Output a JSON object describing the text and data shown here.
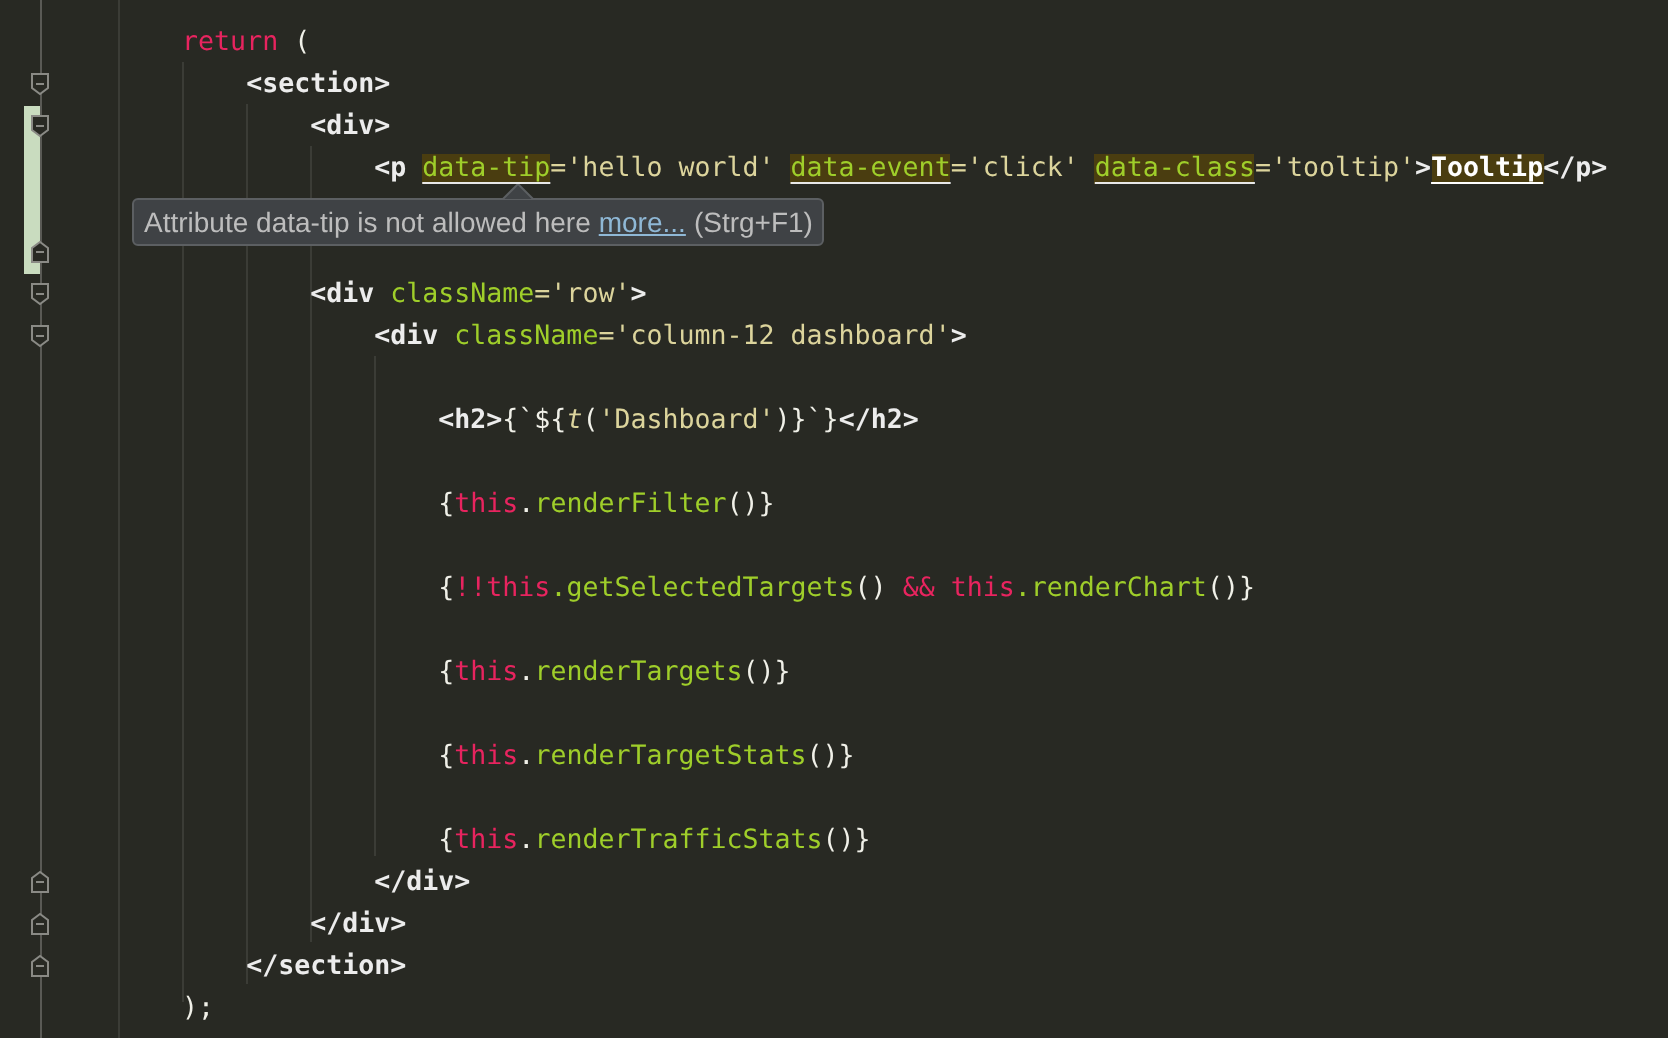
{
  "editor": {
    "lines": [
      {
        "changed": false,
        "kind": "plain",
        "tokens": [
          {
            "kind": "keyword",
            "text": "        return"
          },
          {
            "kind": "punct",
            "text": " ("
          }
        ]
      },
      {
        "changed": false,
        "kind": "fold_start",
        "tokens": [
          {
            "kind": "tag",
            "text": "            <section>"
          }
        ]
      },
      {
        "changed": true,
        "kind": "fold_start",
        "tokens": [
          {
            "kind": "tag",
            "text": "                <div>"
          }
        ]
      },
      {
        "changed": true,
        "kind": "plain",
        "tokens": [
          {
            "kind": "tag",
            "text": "                    <p "
          },
          {
            "kind": "attr_warning",
            "text": "data-tip"
          },
          {
            "kind": "string",
            "text": "='hello world' "
          },
          {
            "kind": "attr_warning",
            "text": "data-event"
          },
          {
            "kind": "string",
            "text": "='click' "
          },
          {
            "kind": "attr_warning",
            "text": "data-class"
          },
          {
            "kind": "string",
            "text": "='tooltip'"
          },
          {
            "kind": "tag",
            "text": ">"
          },
          {
            "kind": "text_warning",
            "text": "Tooltip"
          },
          {
            "kind": "tag",
            "text": "</p>"
          }
        ]
      },
      {
        "changed": true,
        "kind": "plain"
      },
      {
        "changed": true,
        "kind": "fold_end"
      },
      {
        "changed": false,
        "kind": "fold_start",
        "tokens": [
          {
            "kind": "tag",
            "text": "                <div"
          },
          {
            "kind": "attr",
            "text": " className"
          },
          {
            "kind": "string",
            "text": "='row'"
          },
          {
            "kind": "tag",
            "text": ">"
          }
        ]
      },
      {
        "changed": false,
        "kind": "fold_start",
        "tokens": [
          {
            "kind": "tag",
            "text": "                    <div"
          },
          {
            "kind": "attr",
            "text": " className"
          },
          {
            "kind": "string",
            "text": "='column-12 dashboard'"
          },
          {
            "kind": "tag",
            "text": ">"
          }
        ]
      },
      {
        "changed": false,
        "kind": "plain"
      },
      {
        "changed": false,
        "kind": "plain",
        "tokens": [
          {
            "kind": "tag",
            "text": "                        <h2>"
          },
          {
            "kind": "punct",
            "text": "{`${"
          },
          {
            "kind": "call",
            "text": "t"
          },
          {
            "kind": "punct",
            "text": "("
          },
          {
            "kind": "string",
            "text": "'Dashboard'"
          },
          {
            "kind": "punct",
            "text": ")}`}"
          },
          {
            "kind": "tag",
            "text": "</h2>"
          }
        ]
      },
      {
        "changed": false,
        "kind": "plain"
      },
      {
        "changed": false,
        "kind": "plain",
        "tokens": [
          {
            "kind": "punct",
            "text": "                        {"
          },
          {
            "kind": "keyword",
            "text": "this"
          },
          {
            "kind": "punct",
            "text": "."
          },
          {
            "kind": "func",
            "text": "renderFilter"
          },
          {
            "kind": "punct",
            "text": "()}"
          }
        ]
      },
      {
        "changed": false,
        "kind": "plain"
      },
      {
        "changed": false,
        "kind": "plain",
        "tokens": [
          {
            "kind": "punct",
            "text": "                        {"
          },
          {
            "kind": "keyword",
            "text": "!!this"
          },
          {
            "kind": "func",
            "text": ".getSelectedTargets"
          },
          {
            "kind": "punct",
            "text": "() "
          },
          {
            "kind": "keyword",
            "text": "&& this"
          },
          {
            "kind": "func",
            "text": ".renderChart"
          },
          {
            "kind": "punct",
            "text": "()}"
          }
        ]
      },
      {
        "changed": false,
        "kind": "plain"
      },
      {
        "changed": false,
        "kind": "plain",
        "tokens": [
          {
            "kind": "punct",
            "text": "                        {"
          },
          {
            "kind": "keyword",
            "text": "this"
          },
          {
            "kind": "punct",
            "text": "."
          },
          {
            "kind": "func",
            "text": "renderTargets"
          },
          {
            "kind": "punct",
            "text": "()}"
          }
        ]
      },
      {
        "changed": false,
        "kind": "plain"
      },
      {
        "changed": false,
        "kind": "plain",
        "tokens": [
          {
            "kind": "punct",
            "text": "                        {"
          },
          {
            "kind": "keyword",
            "text": "this"
          },
          {
            "kind": "punct",
            "text": "."
          },
          {
            "kind": "func",
            "text": "renderTargetStats"
          },
          {
            "kind": "punct",
            "text": "()}"
          }
        ]
      },
      {
        "changed": false,
        "kind": "plain"
      },
      {
        "changed": false,
        "kind": "plain",
        "tokens": [
          {
            "kind": "punct",
            "text": "                        {"
          },
          {
            "kind": "keyword",
            "text": "this"
          },
          {
            "kind": "punct",
            "text": "."
          },
          {
            "kind": "func",
            "text": "renderTrafficStats"
          },
          {
            "kind": "punct",
            "text": "()}"
          }
        ]
      },
      {
        "changed": false,
        "kind": "fold_end",
        "tokens": [
          {
            "kind": "tag",
            "text": "                    </div>"
          }
        ]
      },
      {
        "changed": false,
        "kind": "fold_end",
        "tokens": [
          {
            "kind": "tag",
            "text": "                </div>"
          }
        ]
      },
      {
        "changed": false,
        "kind": "fold_end",
        "tokens": [
          {
            "kind": "tag",
            "text": "            </section>"
          }
        ]
      },
      {
        "changed": false,
        "kind": "plain",
        "tokens": [
          {
            "kind": "punct",
            "text": "        );"
          }
        ]
      }
    ]
  },
  "tooltip": {
    "message": "Attribute data-tip is not allowed here",
    "link": "more...",
    "shortcut": "(Strg+F1)"
  }
}
